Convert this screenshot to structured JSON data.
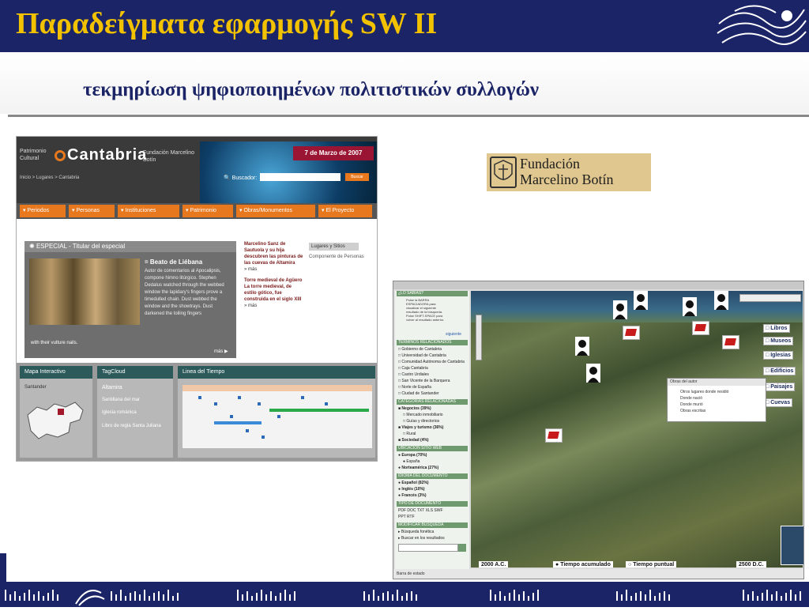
{
  "slide": {
    "title": "Παραδείγματα εφαρμογής SW II",
    "subtitle": "τεκμηρίωση ψηφιοποιημένων πολιτιστικών συλλογών"
  },
  "cantabria_site": {
    "brand_small": "Patrimonio Cultural",
    "brand_name": "Cantabria",
    "foundation": "Fundación Marcelino Botín",
    "date_banner": "7 de Marzo de 2007",
    "breadcrumb": "Inicio > Lugares > Cantabria",
    "search_label": "Buscador:",
    "search_button": "Buscar",
    "nav": [
      "Periodos",
      "Personas",
      "Instituciones",
      "Patrimonio",
      "Obras/Monumentos",
      "El Proyecto"
    ],
    "special_header": "ESPECIAL - Titular del especial",
    "special_title": "Beato de Liébana",
    "special_text": "Autor de comentarios al Apocalipsis, compone himno litúrgico. Stephen Dedalus watched through the webbed window the lapidary's fingers prove a timedulled chain. Dust webbed the window and the showtrays. Dust darkened the toiling fingers",
    "special_footer": "with their vulture nails.",
    "more_label": "más",
    "news1": "Marcelino Sanz de Sautuola y su hija descubren las pinturas de las cuevas de Altamira",
    "news2": "Torre medieval de Agüero La torre medieval, de estilo gótico, fue construida en el siglo XIII",
    "more_link": "más",
    "side_tab": "Lugares y Sitios",
    "side_text": "Componente de Personas",
    "panel_map": "Mapa Interactivo",
    "panel_map_label": "Santander",
    "panel_tag": "TagCloud",
    "tags": [
      "Altamira",
      "Santillana del mar",
      "Iglesia románica",
      "Libro de regla Santa Juliana"
    ],
    "panel_timeline": "Linea del Tiempo"
  },
  "foundation_logo": {
    "line1": "Fundación",
    "line2": "Marcelino Botín"
  },
  "map_app": {
    "help_title": "¿LO SABÍAS?",
    "help_text": "Pulse la BARRA ESPACIADORA para visualizar el siguiente resultado de la búsqueda. Pulse SHIFT-SPACE para volver al resultado anterior.",
    "next_label": "siguiente",
    "sections": [
      "TÉRMINOS RELACIONADOS",
      "CATEGORÍAS RELACIONADAS",
      "UBICACIÓN SITIO WEB",
      "IDIOMA DEL DOCUMENTO",
      "TIPO DE DOCUMENTO",
      "MODIFICAR BÚSQUEDA"
    ],
    "terms": [
      "Gobierno de Cantabria",
      "Universidad de Cantabria",
      "Comunidad Autónoma de Cantabria",
      "Caja Cantabria",
      "Castro Urdiales",
      "San Vicente de la Barquera",
      "Norte de España",
      "Ciudad de Santander"
    ],
    "categories": [
      "Negocios (39%)",
      "Mercado inmobiliario",
      "Guías y directorios",
      "Viajes y turismo (36%)",
      "Rural",
      "Sociedad (4%)"
    ],
    "locations": [
      "Europa (70%)",
      "España",
      "Norteamérica (27%)"
    ],
    "languages": [
      "Español (82%)",
      "Inglés (10%)",
      "Francés (3%)"
    ],
    "doc_types": [
      "PDF",
      "DOC",
      "TXT",
      "XLS",
      "SWF",
      "PPT",
      "RTF"
    ],
    "modify": [
      "Búsqueda fonética",
      "Buscar en los resultados"
    ],
    "layers": [
      "Libros",
      "Museos",
      "Iglesias",
      "Edificios",
      "Paisajes",
      "Cuevas"
    ],
    "popup_title": "Obras del autor",
    "popup_items": [
      "Otros lugares donde residió",
      "Donde nació",
      "Donde murió",
      "Obras escritas"
    ],
    "time_start": "2000 A.C.",
    "time_acc": "Tiempo acumulado",
    "time_pt": "Tiempo puntual",
    "time_end": "2500 D.C.",
    "status": "Barra de estado"
  }
}
